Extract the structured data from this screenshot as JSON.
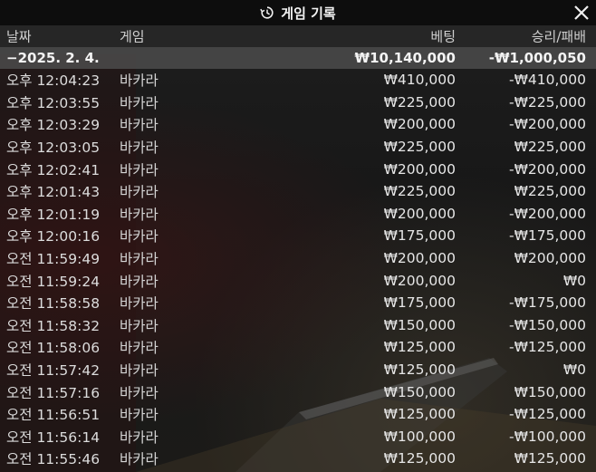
{
  "window": {
    "title": "게임 기록",
    "icons": {
      "history": "history-icon",
      "close": "close-icon"
    }
  },
  "columns": {
    "date": "날짜",
    "game": "게임",
    "bet": "베팅",
    "win_loss": "승리/패배"
  },
  "group": {
    "date": "−2025. 2. 4.",
    "total_bet": "₩10,140,000",
    "total_win_loss": "-₩1,000,050"
  },
  "rows": [
    {
      "time": "오후 12:04:23",
      "game": "바카라",
      "bet": "₩410,000",
      "result": "-₩410,000"
    },
    {
      "time": "오후 12:03:55",
      "game": "바카라",
      "bet": "₩225,000",
      "result": "-₩225,000"
    },
    {
      "time": "오후 12:03:29",
      "game": "바카라",
      "bet": "₩200,000",
      "result": "-₩200,000"
    },
    {
      "time": "오후 12:03:05",
      "game": "바카라",
      "bet": "₩225,000",
      "result": "₩225,000"
    },
    {
      "time": "오후 12:02:41",
      "game": "바카라",
      "bet": "₩200,000",
      "result": "-₩200,000"
    },
    {
      "time": "오후 12:01:43",
      "game": "바카라",
      "bet": "₩225,000",
      "result": "₩225,000"
    },
    {
      "time": "오후 12:01:19",
      "game": "바카라",
      "bet": "₩200,000",
      "result": "-₩200,000"
    },
    {
      "time": "오후 12:00:16",
      "game": "바카라",
      "bet": "₩175,000",
      "result": "-₩175,000"
    },
    {
      "time": "오전 11:59:49",
      "game": "바카라",
      "bet": "₩200,000",
      "result": "₩200,000"
    },
    {
      "time": "오전 11:59:24",
      "game": "바카라",
      "bet": "₩200,000",
      "result": "₩0"
    },
    {
      "time": "오전 11:58:58",
      "game": "바카라",
      "bet": "₩175,000",
      "result": "-₩175,000"
    },
    {
      "time": "오전 11:58:32",
      "game": "바카라",
      "bet": "₩150,000",
      "result": "-₩150,000"
    },
    {
      "time": "오전 11:58:06",
      "game": "바카라",
      "bet": "₩125,000",
      "result": "-₩125,000"
    },
    {
      "time": "오전 11:57:42",
      "game": "바카라",
      "bet": "₩125,000",
      "result": "₩0"
    },
    {
      "time": "오전 11:57:16",
      "game": "바카라",
      "bet": "₩150,000",
      "result": "₩150,000"
    },
    {
      "time": "오전 11:56:51",
      "game": "바카라",
      "bet": "₩125,000",
      "result": "-₩125,000"
    },
    {
      "time": "오전 11:56:14",
      "game": "바카라",
      "bet": "₩100,000",
      "result": "-₩100,000"
    },
    {
      "time": "오전 11:55:46",
      "game": "바카라",
      "bet": "₩125,000",
      "result": "₩125,000"
    }
  ]
}
